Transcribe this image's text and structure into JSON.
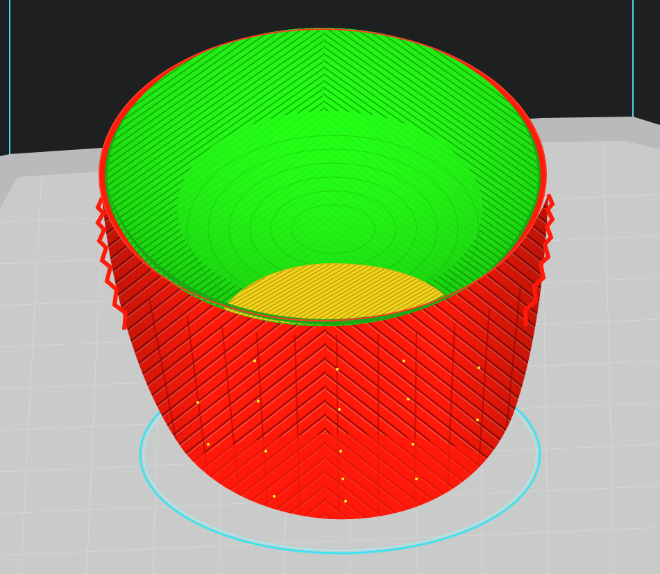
{
  "viewport": {
    "background_color": "#1d1f20",
    "build_plate_color": "#b9babb",
    "build_plate_inner_color": "#c9caca",
    "grid_line_color": "#d8d8d8",
    "volume_edge_color": "#4fd0e8"
  },
  "model": {
    "outer_wall_color": "#ff1a0a",
    "inner_wall_color": "#20ff14",
    "infill_color": "#f2d21b",
    "skirt_color": "#3de4f0",
    "seam_color": "#f3f02a"
  }
}
